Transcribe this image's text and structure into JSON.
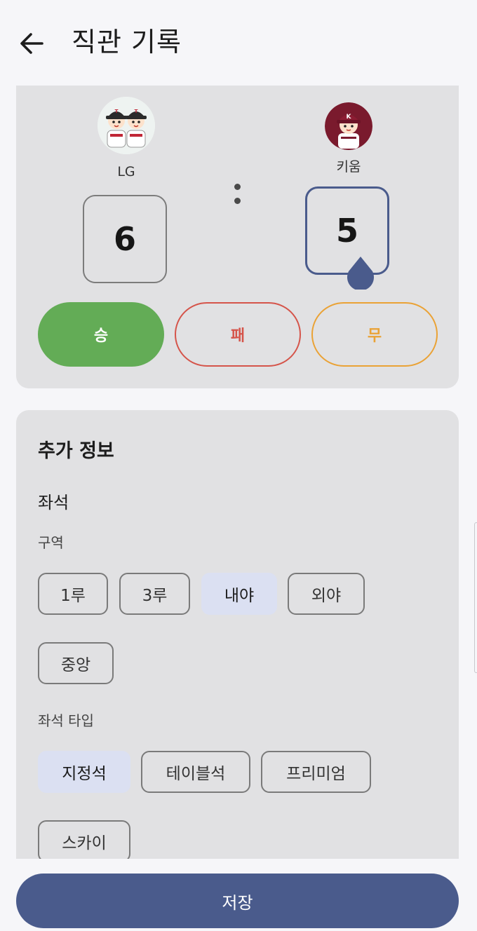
{
  "header": {
    "title": "직관 기록",
    "back_icon": "arrow-left-icon"
  },
  "match": {
    "home": {
      "name": "LG",
      "score": "6",
      "mascot_icon": "lg-twins-mascot-icon"
    },
    "away": {
      "name": "키움",
      "score": "5",
      "mascot_icon": "kiwoom-heroes-mascot-icon"
    },
    "active_score": "away"
  },
  "result_options": [
    {
      "label": "승",
      "selected": true,
      "color": "#63ac56"
    },
    {
      "label": "패",
      "selected": false,
      "color": "#d5544a"
    },
    {
      "label": "무",
      "selected": false,
      "color": "#eaa235"
    }
  ],
  "extra_info": {
    "title": "추가 정보",
    "seat_section_title": "좌석",
    "zone_label": "구역",
    "zones": [
      {
        "label": "1루",
        "selected": false
      },
      {
        "label": "3루",
        "selected": false
      },
      {
        "label": "내야",
        "selected": true
      },
      {
        "label": "외야",
        "selected": false
      },
      {
        "label": "중앙",
        "selected": false
      }
    ],
    "seat_type_label": "좌석 타입",
    "seat_types": [
      {
        "label": "지정석",
        "selected": true
      },
      {
        "label": "테이블석",
        "selected": false
      },
      {
        "label": "프리미엄",
        "selected": false
      },
      {
        "label": "스카이",
        "selected": false
      }
    ]
  },
  "save_label": "저장",
  "colors": {
    "accent": "#4a5b8c",
    "card_bg": "#e1e1e3",
    "selected_chip": "#dbe0f2"
  }
}
